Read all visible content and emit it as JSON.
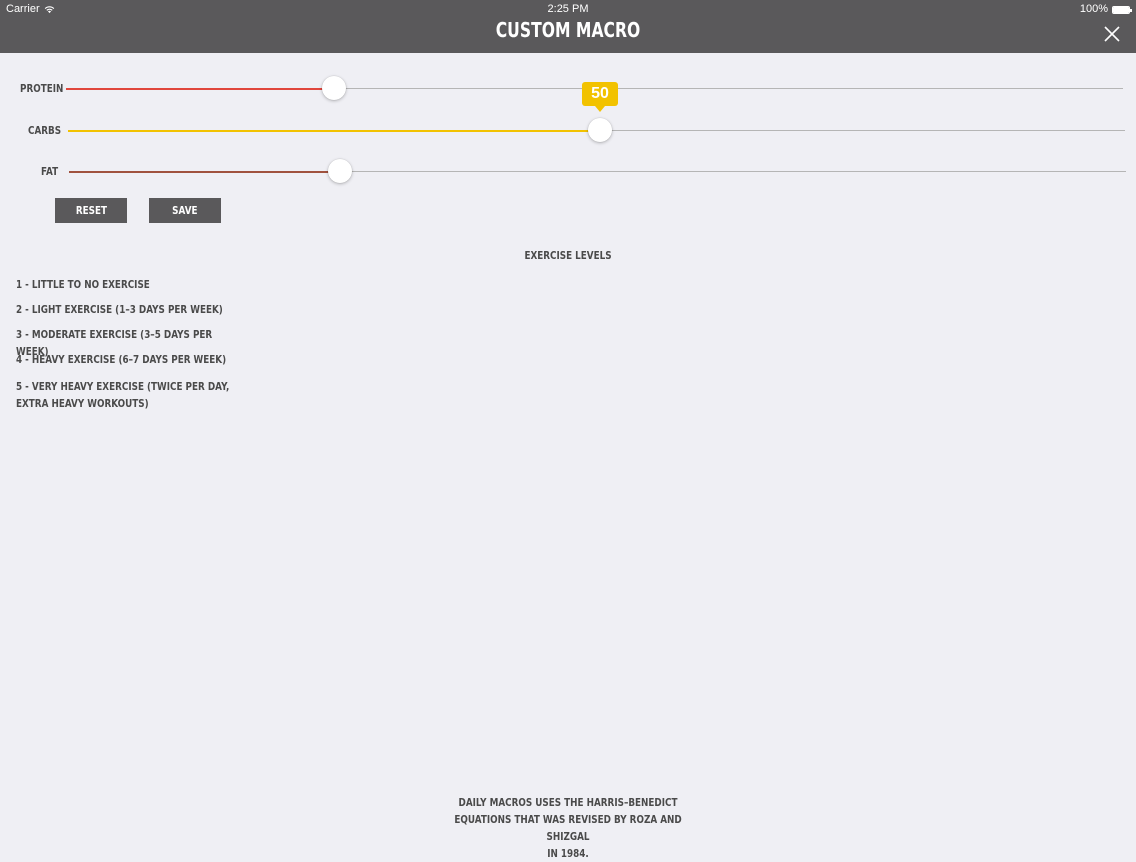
{
  "status_bar": {
    "carrier": "Carrier",
    "time": "2:25 PM",
    "battery": "100%",
    "icons": [
      "wifi-icon",
      "battery-icon"
    ]
  },
  "header": {
    "title": "CUSTOM MACRO",
    "close_icon": "close-icon"
  },
  "sliders": [
    {
      "label": "PROTEIN",
      "value_fraction": 0.254,
      "fill_color": "#e0463c"
    },
    {
      "label": "CARBS",
      "value": "50",
      "value_fraction": 0.503,
      "fill_color": "#f2c200"
    },
    {
      "label": "FAT",
      "value_fraction": 0.256,
      "fill_color": "#a0523e"
    }
  ],
  "buttons": {
    "reset": "RESET",
    "save": "SAVE"
  },
  "exercise": {
    "title": "EXERCISE LEVELS",
    "levels": [
      "1 - LITTLE TO NO EXERCISE",
      "2 - LIGHT EXERCISE (1–3 DAYS PER WEEK)",
      "3 - MODERATE EXERCISE (3–5 DAYS PER WEEK)",
      "4 - HEAVY EXERCISE (6–7 DAYS PER WEEK)",
      "5 - VERY HEAVY EXERCISE (TWICE PER DAY, EXTRA HEAVY WORKOUTS)"
    ]
  },
  "footer": {
    "line1": "DAILY MACROS USES THE HARRIS–BENEDICT",
    "line2": "EQUATIONS THAT WAS REVISED BY ROZA AND SHIZGAL",
    "line3": "IN 1984."
  },
  "colors": {
    "header_bg": "#5a595b",
    "page_bg": "#efeff4",
    "accent_yellow": "#f2c200"
  }
}
